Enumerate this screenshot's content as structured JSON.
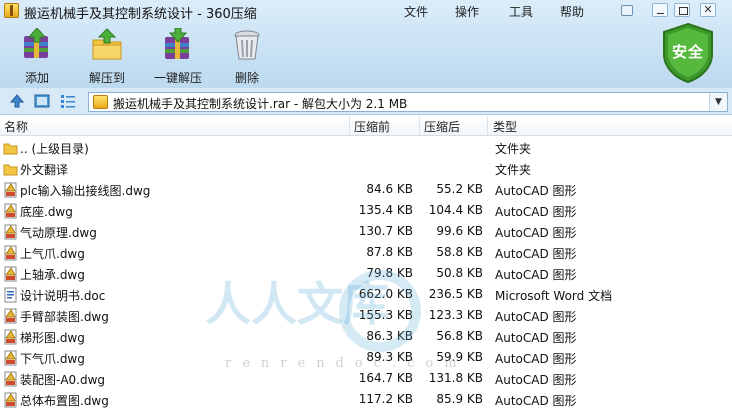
{
  "window": {
    "title": "搬运机械手及其控制系统设计 - 360压缩",
    "menu": [
      "文件",
      "操作",
      "工具",
      "帮助"
    ],
    "controls": [
      "minimize",
      "maximize",
      "close"
    ]
  },
  "toolbar": {
    "buttons": [
      {
        "label": "添加",
        "icon": "add-archive-icon"
      },
      {
        "label": "解压到",
        "icon": "extract-to-icon"
      },
      {
        "label": "一键解压",
        "icon": "one-click-extract-icon"
      },
      {
        "label": "删除",
        "icon": "trash-icon"
      }
    ],
    "security_badge": "安全"
  },
  "address": {
    "path": "搬运机械手及其控制系统设计.rar - 解包大小为 2.1 MB"
  },
  "columns": {
    "name": "名称",
    "size": "压缩前",
    "packed": "压缩后",
    "type": "类型"
  },
  "files": [
    {
      "name": ".. (上级目录)",
      "size": "",
      "packed": "",
      "type": "文件夹",
      "icon": "folder-up-icon"
    },
    {
      "name": "外文翻译",
      "size": "",
      "packed": "",
      "type": "文件夹",
      "icon": "folder-icon"
    },
    {
      "name": "plc输入输出接线图.dwg",
      "size": "84.6 KB",
      "packed": "55.2 KB",
      "type": "AutoCAD 图形",
      "icon": "dwg-file-icon"
    },
    {
      "name": "底座.dwg",
      "size": "135.4 KB",
      "packed": "104.4 KB",
      "type": "AutoCAD 图形",
      "icon": "dwg-file-icon"
    },
    {
      "name": "气动原理.dwg",
      "size": "130.7 KB",
      "packed": "99.6 KB",
      "type": "AutoCAD 图形",
      "icon": "dwg-file-icon"
    },
    {
      "name": "上气爪.dwg",
      "size": "87.8 KB",
      "packed": "58.8 KB",
      "type": "AutoCAD 图形",
      "icon": "dwg-file-icon"
    },
    {
      "name": "上轴承.dwg",
      "size": "79.8 KB",
      "packed": "50.8 KB",
      "type": "AutoCAD 图形",
      "icon": "dwg-file-icon"
    },
    {
      "name": "设计说明书.doc",
      "size": "662.0 KB",
      "packed": "236.5 KB",
      "type": "Microsoft Word 文档",
      "icon": "doc-file-icon"
    },
    {
      "name": "手臂部装图.dwg",
      "size": "155.3 KB",
      "packed": "123.3 KB",
      "type": "AutoCAD 图形",
      "icon": "dwg-file-icon"
    },
    {
      "name": "梯形图.dwg",
      "size": "86.3 KB",
      "packed": "56.8 KB",
      "type": "AutoCAD 图形",
      "icon": "dwg-file-icon"
    },
    {
      "name": "下气爪.dwg",
      "size": "89.3 KB",
      "packed": "59.9 KB",
      "type": "AutoCAD 图形",
      "icon": "dwg-file-icon"
    },
    {
      "name": "装配图-A0.dwg",
      "size": "164.7 KB",
      "packed": "131.8 KB",
      "type": "AutoCAD 图形",
      "icon": "dwg-file-icon"
    },
    {
      "name": "总体布置图.dwg",
      "size": "117.2 KB",
      "packed": "85.9 KB",
      "type": "AutoCAD 图形",
      "icon": "dwg-file-icon"
    }
  ],
  "watermark": {
    "big": "人人文库",
    "small": "renrendoc.com"
  },
  "colors": {
    "chrome": "#c9e2f4",
    "badge_green": "#3f9a2c",
    "watermark": "#5aaad7"
  }
}
